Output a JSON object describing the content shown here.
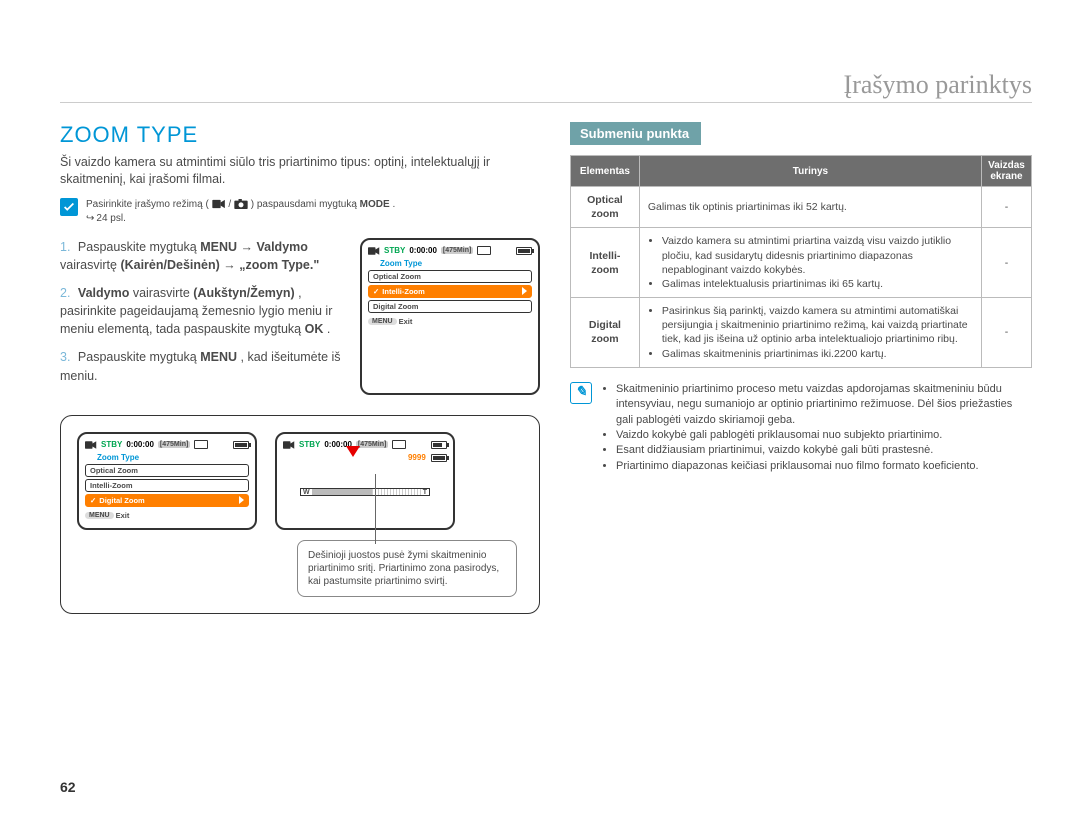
{
  "header": {
    "chapter_title": "Įrašymo parinktys"
  },
  "left": {
    "section_title": "ZOOM TYPE",
    "intro": "Ši vaizdo kamera su atmintimi siūlo tris priartinimo tipus: optinį, intelektualųjį ir skaitmeninį, kai įrašomi filmai.",
    "precheck": {
      "text_a": "Pasirinkite įrašymo režimą (",
      "text_b": " / ",
      "text_c": " ) paspausdami mygtuką ",
      "mode": "MODE",
      "text_d": ".",
      "page_arrow": "↪",
      "page_ref": "24 psl."
    },
    "steps": {
      "s1a": "Paspauskite mygtuką ",
      "s1_menu": "MENU",
      "s1_arrow": " → ",
      "s1b": "Valdymo ",
      "s1c": "vairasvirtę ",
      "s1d": "(Kairėn/Dešinėn)",
      "s1_arrow2": " → ",
      "s1e": "„zoom Type.\"",
      "s2a": "Valdymo ",
      "s2b": "vairasvirte ",
      "s2c": "(Aukštyn/Žemyn)",
      "s2d": ", pasirinkite pageidaujamą žemesnio lygio meniu ir meniu elementą, tada paspauskite mygtuką ",
      "s2_ok": "OK",
      "s2e": ".",
      "s3a": "Paspauskite mygtuką ",
      "s3_menu": "MENU",
      "s3b": ", kad išeitumėte iš meniu."
    },
    "camera": {
      "stby": "STBY",
      "time": "0:00:00",
      "remain": "[475Min]",
      "title": "Zoom Type",
      "items": [
        "Optical Zoom",
        "Intelli-Zoom",
        "Digital Zoom"
      ],
      "menu": "MENU",
      "exit": "Exit",
      "count": "9999",
      "wt_w": "W",
      "wt_t": "T"
    },
    "zoom_caption": "Dešinioji juostos pusė žymi skaitmeninio priartinimo sritį. Priartinimo zona pasirodys, kai pastumsite priartinimo svirtį."
  },
  "right": {
    "submeniu_label": "Submeniu punkta",
    "table": {
      "headers": [
        "Elementas",
        "Turinys",
        "Vaizdas ekrane"
      ],
      "rows": [
        {
          "elem": "Optical zoom",
          "content_single": "Galimas tik optinis priartinimas iki 52 kartų.",
          "display": "-"
        },
        {
          "elem": "Intelli-zoom",
          "content_list": [
            "Vaizdo kamera su atmintimi priartina vaizdą visu vaizdo jutiklio pločiu, kad susidarytų didesnis priartinimo diapazonas nepabloginant vaizdo kokybės.",
            "Galimas intelektualusis priartinimas iki 65 kartų."
          ],
          "display": "-"
        },
        {
          "elem": "Digital zoom",
          "content_list": [
            "Pasirinkus šią parinktį, vaizdo kamera su atmintimi automatiškai persijungia į skaitmeninio priartinimo režimą, kai vaizdą priartinate tiek, kad jis išeina už optinio arba intelektualiojo priartinimo ribų.",
            "Galimas skaitmeninis priartinimas iki.2200 kartų."
          ],
          "display": "-"
        }
      ]
    },
    "notes": [
      "Skaitmeninio priartinimo proceso metu vaizdas apdorojamas skaitmeniniu būdu intensyviau, negu sumaniojo ar optinio priartinimo režimuose. Dėl šios priežasties gali pablogėti vaizdo skiriamoji geba.",
      "Vaizdo kokybė gali pablogėti priklausomai nuo subjekto priartinimo.",
      "Esant didžiausiam priartinimui, vaizdo kokybė gali būti prastesnė.",
      "Priartinimo diapazonas keičiasi priklausomai nuo filmo formato koeficiento."
    ]
  },
  "page_number": "62"
}
